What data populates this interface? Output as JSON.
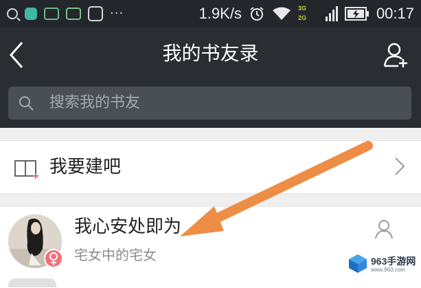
{
  "status_bar": {
    "network_speed": "1.9K/s",
    "network_type_top": "3G",
    "network_type_bottom": "2G",
    "time": "00:17"
  },
  "header": {
    "title": "我的书友录"
  },
  "search": {
    "placeholder": "搜索我的书友"
  },
  "list": {
    "build_row_label": "我要建吧",
    "friends": [
      {
        "name": "我心安处即为",
        "description": "宅女中的宅女",
        "gender": "female"
      }
    ]
  },
  "watermark": {
    "brand": "963手游网",
    "url": "www.963.com"
  },
  "colors": {
    "header_bg": "#2a2e33",
    "status_bg": "#23262b",
    "search_box": "#4a4f55",
    "annotation_arrow": "#ee8d45",
    "female_badge": "#f0707c"
  },
  "icons": [
    "search-icon",
    "back-icon",
    "add-friend-icon",
    "book-icon",
    "chevron-right-icon",
    "person-icon",
    "female-icon",
    "alarm-icon",
    "wifi-icon",
    "signal-icon",
    "battery-icon"
  ]
}
